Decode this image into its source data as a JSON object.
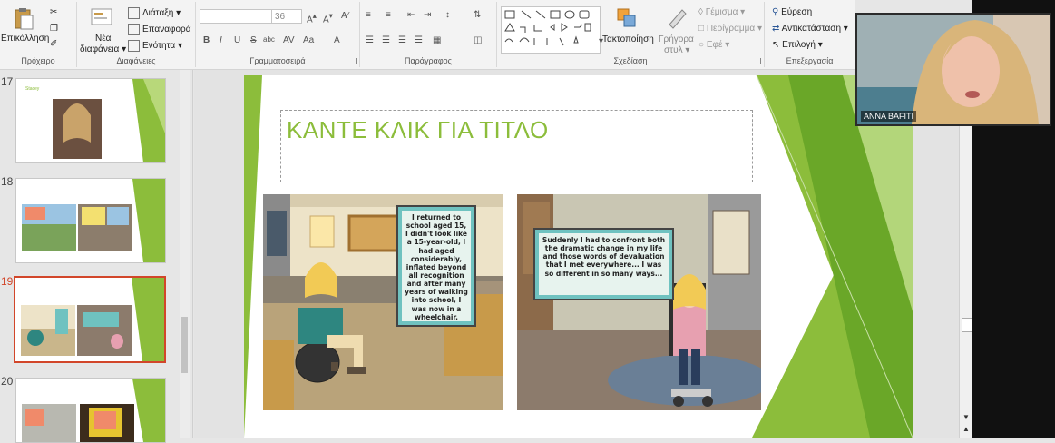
{
  "ribbon": {
    "clipboard": {
      "group_label": "Πρόχειρο",
      "paste_label": "Επικόλληση"
    },
    "slides": {
      "group_label": "Διαφάνειες",
      "new_slide_label": "Νέα",
      "new_slide_label2": "διαφάνεια",
      "layout_label": "Διάταξη",
      "reset_label": "Επαναφορά",
      "section_label": "Ενότητα"
    },
    "font": {
      "group_label": "Γραμματοσειρά",
      "font_name": "",
      "font_size": "36",
      "bold": "B",
      "italic": "I",
      "underline": "U",
      "strike": "S",
      "shadow": "abc",
      "spacing": "AV",
      "case": "Aa",
      "color": "A"
    },
    "paragraph": {
      "group_label": "Παράγραφος"
    },
    "drawing": {
      "group_label": "Σχεδίαση",
      "arrange_label": "Τακτοποίηση",
      "quick_styles_label": "Γρήγορα",
      "quick_styles_label2": "στυλ",
      "fill_label": "Γέμισμα",
      "outline_label": "Περίγραμμα",
      "effects_label": "Εφέ"
    },
    "editing": {
      "group_label": "Επεξεργασία",
      "find_label": "Εύρεση",
      "replace_label": "Αντικατάσταση",
      "select_label": "Επιλογή"
    }
  },
  "thumbnails": [
    {
      "number": "17",
      "caption": "Stacey"
    },
    {
      "number": "18"
    },
    {
      "number": "19",
      "selected": true
    },
    {
      "number": "20"
    }
  ],
  "slide": {
    "title_placeholder": "ΚΑΝΤΕ ΚΛΙΚ ΓΙΑ ΤΙΤΛΟ",
    "panel_left_caption": "I returned to school aged 15, I didn't look like a 15-year-old, I had aged considerably, inflated beyond all recognition and after many years of walking into school, I was now in a wheelchair.",
    "panel_right_caption": "Suddenly I had to confront both the dramatic change in my life and those words of devaluation that I met everywhere... I was so different in so many ways..."
  },
  "webcam": {
    "participant_name": "ANNA BAFITI"
  },
  "colors": {
    "accent_green": "#8cbd3b",
    "selected_border": "#d2462a",
    "caption_teal": "#6fc2c0"
  }
}
